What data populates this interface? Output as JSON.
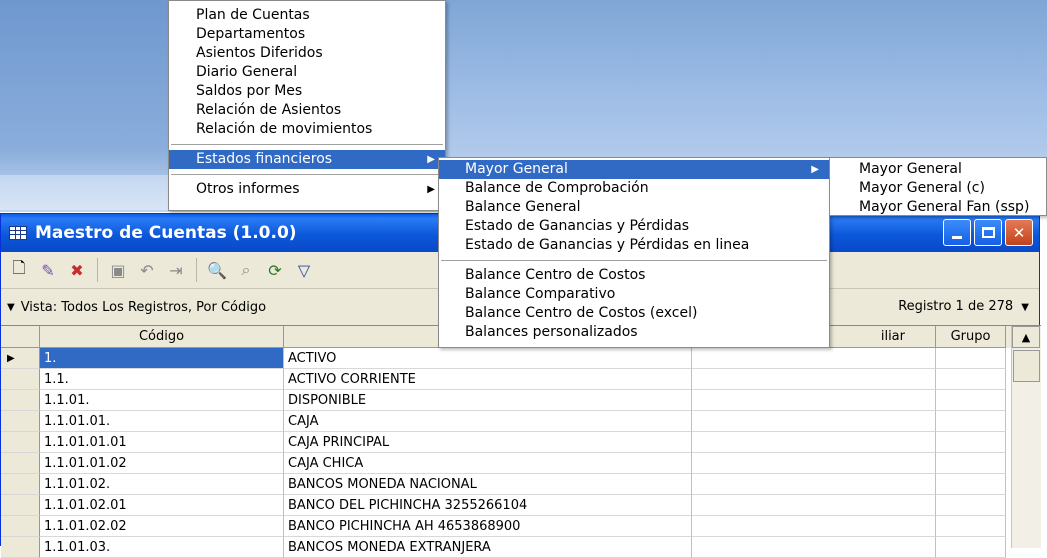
{
  "window": {
    "title": "Maestro de Cuentas (1.0.0)"
  },
  "viewbar": {
    "view_label": "Vista: Todos Los Registros, Por Código",
    "record_label": "Registro 1 de 278"
  },
  "grid": {
    "columns": [
      "Código",
      "",
      "iliar",
      "Grupo"
    ],
    "rows": [
      {
        "code": "1.",
        "name": "ACTIVO"
      },
      {
        "code": "1.1.",
        "name": "ACTIVO CORRIENTE"
      },
      {
        "code": "1.1.01.",
        "name": "DISPONIBLE"
      },
      {
        "code": "1.1.01.01.",
        "name": "CAJA"
      },
      {
        "code": "1.1.01.01.01",
        "name": "CAJA PRINCIPAL"
      },
      {
        "code": "1.1.01.01.02",
        "name": "CAJA CHICA"
      },
      {
        "code": "1.1.01.02.",
        "name": "BANCOS MONEDA NACIONAL"
      },
      {
        "code": "1.1.01.02.01",
        "name": "BANCO DEL PICHINCHA 3255266104"
      },
      {
        "code": "1.1.01.02.02",
        "name": "BANCO PICHINCHA AH 4653868900"
      },
      {
        "code": "1.1.01.03.",
        "name": "BANCOS MONEDA EXTRANJERA"
      }
    ]
  },
  "menu1": {
    "items": [
      "Plan de Cuentas",
      "Departamentos",
      "Asientos Diferidos",
      "Diario General",
      "Saldos por Mes",
      "Relación de Asientos",
      "Relación de movimientos",
      "Estados financieros",
      "Otros informes"
    ]
  },
  "menu2": {
    "items": [
      "Mayor General",
      "Balance de Comprobación",
      "Balance General",
      "Estado de Ganancias y Pérdidas",
      "Estado de Ganancias y Pérdidas en linea",
      "Balance Centro de Costos",
      "Balance Comparativo",
      "Balance Centro de Costos (excel)",
      "Balances personalizados"
    ]
  },
  "menu3": {
    "items": [
      "Mayor General",
      "Mayor General (c)",
      "Mayor General Fan (ssp)"
    ]
  },
  "toolbar": {
    "icons": [
      "new-icon",
      "edit-icon",
      "delete-icon",
      "save-icon",
      "undo-icon",
      "link-icon",
      "find-icon",
      "find-next-icon",
      "refresh-icon",
      "filter-icon"
    ]
  },
  "colors": {
    "title_bar": "#0a58db",
    "highlight": "#316ac5",
    "menu_bg": "#ffffff",
    "window_bg": "#ece9d8"
  }
}
